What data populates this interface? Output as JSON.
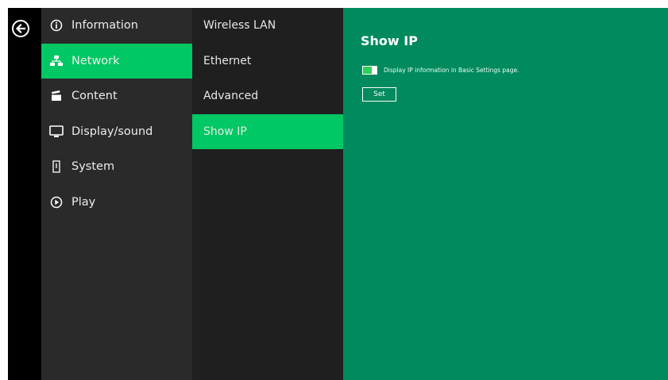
{
  "nav": {
    "items": [
      {
        "label": "Information",
        "icon": "info-icon"
      },
      {
        "label": "Network",
        "icon": "network-icon",
        "active": true
      },
      {
        "label": "Content",
        "icon": "clapperboard-icon"
      },
      {
        "label": "Display/sound",
        "icon": "monitor-icon"
      },
      {
        "label": "System",
        "icon": "tower-icon"
      },
      {
        "label": "Play",
        "icon": "play-icon"
      }
    ]
  },
  "submenu": {
    "items": [
      {
        "label": "Wireless LAN"
      },
      {
        "label": "Ethernet"
      },
      {
        "label": "Advanced"
      },
      {
        "label": "Show IP",
        "active": true
      }
    ]
  },
  "panel": {
    "title": "Show IP",
    "option_label": "Display IP information in Basic Settings page.",
    "option_enabled": true,
    "set_label": "Set"
  },
  "colors": {
    "accent": "#00c864",
    "panel_bg": "#008a5e",
    "nav_bg": "#2a2a2a",
    "submenu_bg": "#1f1f1f"
  }
}
